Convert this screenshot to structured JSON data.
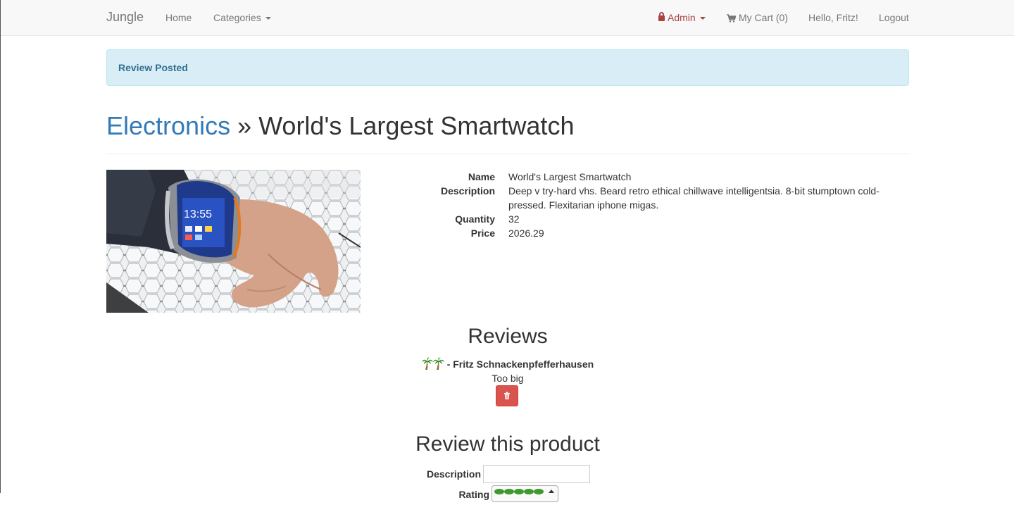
{
  "nav": {
    "brand": "Jungle",
    "home": "Home",
    "categories": "Categories",
    "admin": "Admin",
    "cart": "My Cart (0)",
    "greeting": "Hello, Fritz!",
    "logout": "Logout"
  },
  "alert": {
    "message": "Review Posted"
  },
  "header": {
    "category": "Electronics",
    "separator": " » ",
    "product_name": "World's Largest Smartwatch"
  },
  "details": {
    "name_label": "Name",
    "name_value": "World's Largest Smartwatch",
    "description_label": "Description",
    "description_value": "Deep v try-hard vhs. Beard retro ethical chillwave intelligentsia. 8-bit stumptown cold-pressed. Flexitarian iphone migas.",
    "quantity_label": "Quantity",
    "quantity_value": "32",
    "price_label": "Price",
    "price_value": "2026.29"
  },
  "reviews": {
    "title": "Reviews",
    "items": [
      {
        "rating": 2,
        "author": "- Fritz Schnackenpfefferhausen",
        "description": "Too big"
      }
    ]
  },
  "review_form": {
    "title": "Review this product",
    "description_label": "Description",
    "rating_label": "Rating"
  },
  "colors": {
    "link": "#337ab7",
    "admin": "#a94442",
    "alert_bg": "#d9edf7",
    "alert_text": "#31708f",
    "danger": "#d9534f"
  }
}
